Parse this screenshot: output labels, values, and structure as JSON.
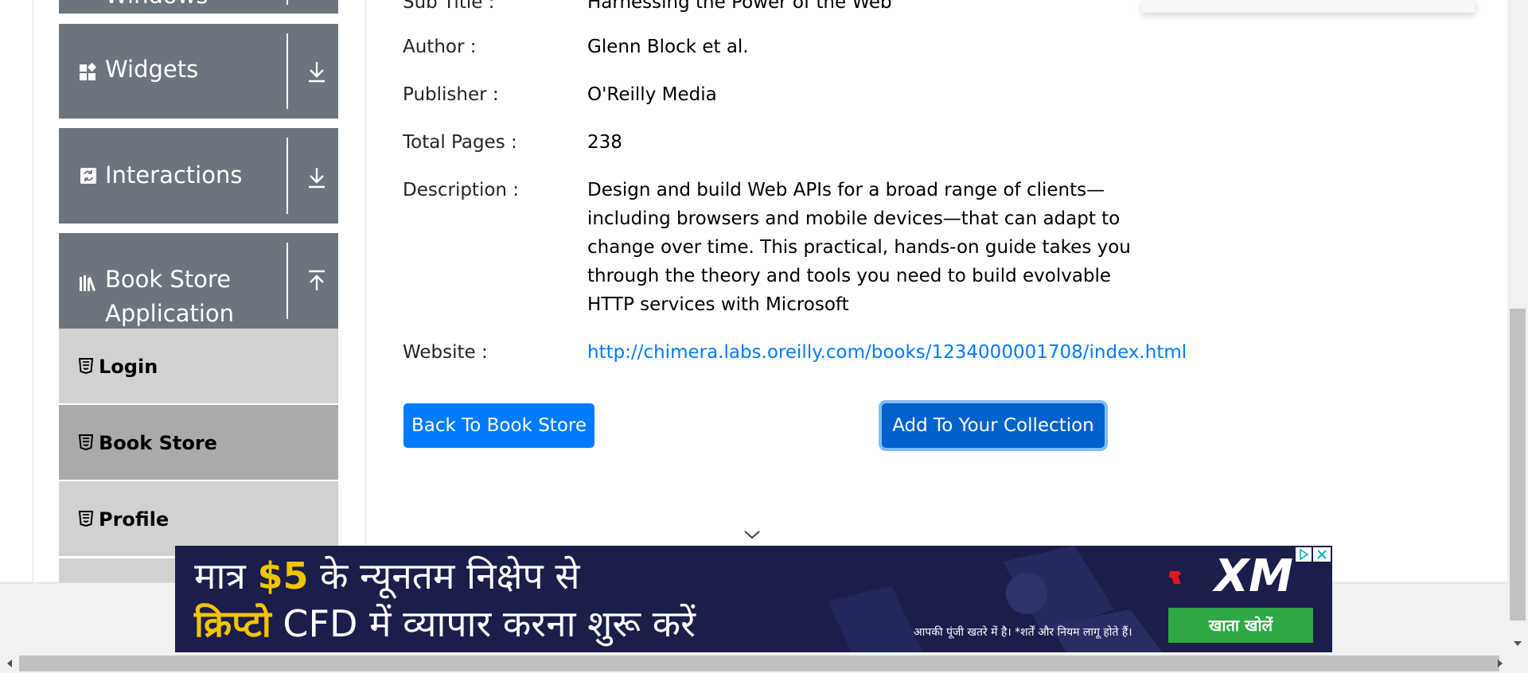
{
  "sidebar": {
    "groups": [
      {
        "label": "Windows",
        "icon": "windows-icon",
        "state": "collapsed"
      },
      {
        "label": "Widgets",
        "icon": "widgets-icon",
        "state": "collapsed"
      },
      {
        "label": "Interactions",
        "icon": "interactions-icon",
        "state": "collapsed"
      },
      {
        "label_line1": "Book Store",
        "label_line2": "Application",
        "icon": "books-icon",
        "state": "expanded"
      }
    ],
    "items": [
      {
        "label": "Login",
        "icon": "html5-icon",
        "active": false
      },
      {
        "label": "Book Store",
        "icon": "html5-icon",
        "active": true
      },
      {
        "label": "Profile",
        "icon": "html5-icon",
        "active": false
      }
    ]
  },
  "book": {
    "subtitle_label": "Sub Title :",
    "subtitle": "Harnessing the Power of the Web",
    "author_label": "Author :",
    "author": "Glenn Block et al.",
    "publisher_label": "Publisher :",
    "publisher": "O'Reilly Media",
    "pages_label": "Total Pages :",
    "pages": "238",
    "description_label": "Description :",
    "description_lines": [
      "Design and build Web APIs for a broad range of clients—",
      "including browsers and mobile devices—that can adapt to",
      "change over time. This practical, hands-on guide takes you",
      "through the theory and tools you need to build evolvable",
      "HTTP services with Microsoft"
    ],
    "website_label": "Website :",
    "website": "http://chimera.labs.oreilly.com/books/1234000001708/index.html"
  },
  "actions": {
    "back_label": "Back To Book Store",
    "add_label": "Add To Your Collection"
  },
  "ad": {
    "line1_pre": "मात्र ",
    "line1_hl": "$5",
    "line1_post": " के न्यूनतम निक्षेप से",
    "line2_hl": "क्रिप्टो",
    "line2_post": " CFD में  व्यापार करना शुरू करें",
    "brand": "XM",
    "disclaimer": "आपकी पूंजी खतरे में है। *शर्तें और नियम लागू होते हैं।",
    "cta": "खाता खोलें"
  },
  "colors": {
    "sidebar_group": "#6c757d",
    "sidebar_item": "#d1d1d1",
    "sidebar_item_active": "#aaaaaa",
    "primary": "#007bff",
    "primary_active": "#0062cc",
    "ad_bg": "#1b1d4a",
    "ad_cta": "#2fa844",
    "ad_highlight": "#f4c400"
  }
}
